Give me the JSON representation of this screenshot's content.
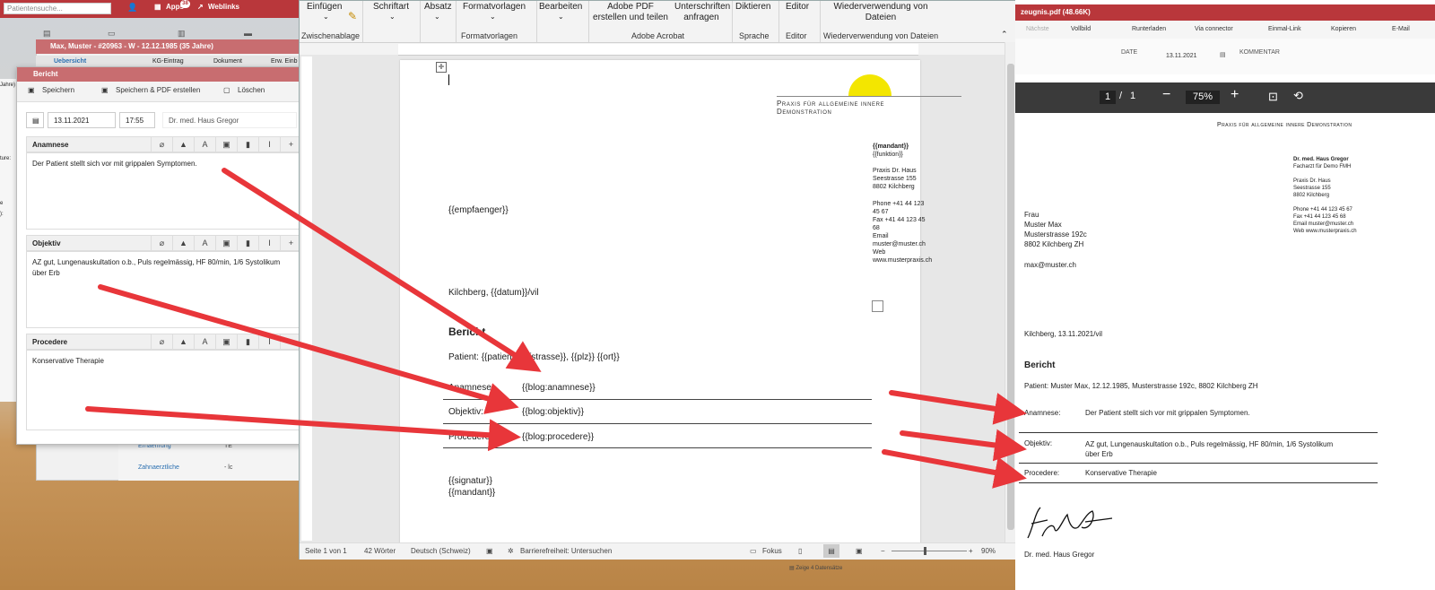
{
  "ehr": {
    "search_placeholder": "Patientensuche...",
    "top_apps": "Apps",
    "top_apps_badge": "38",
    "top_weblinks": "Weblinks",
    "back_window_title": "Max, Muster - #20963 - W - 12.12.1985 (35 Jahre)",
    "back_tabs": [
      "Uebersicht",
      "KG-Eintrag",
      "Dokument",
      "Erw. Einb"
    ],
    "list_items": [
      "Ernaehrung",
      "Zahnaerztliche"
    ],
    "list_values": [
      "TE",
      "- lc"
    ],
    "sidebar_fragments": [
      "Jahre)",
      "ture:",
      "e",
      "):"
    ]
  },
  "modal": {
    "title": "Bericht",
    "btn_save": "Speichern",
    "btn_save_pdf": "Speichern & PDF erstellen",
    "btn_delete": "Löschen",
    "date": "13.11.2021",
    "time": "17:55",
    "doctor": "Dr. med. Haus Gregor",
    "sections": [
      {
        "label": "Anamnese",
        "text": "Der Patient stellt sich vor mit grippalen Symptomen."
      },
      {
        "label": "Objektiv",
        "text": "AZ gut, Lungenauskultation o.b., Puls regelmässig, HF 80/min, 1/6 Systolikum über Erb"
      },
      {
        "label": "Procedere",
        "text": "Konservative Therapie"
      }
    ]
  },
  "word": {
    "ribbon": {
      "einfuegen": "Einfügen",
      "zwischenablage": "Zwischenablage",
      "schriftart": "Schriftart",
      "absatz": "Absatz",
      "formatvorlagen": "Formatvorlagen",
      "formatvorlagen_group": "Formatvorlagen",
      "bearbeiten": "Bearbeiten",
      "adobe_pdf": "Adobe PDF erstellen und teilen",
      "unterschriften": "Unterschriften anfragen",
      "adobe_group": "Adobe Acrobat",
      "diktieren": "Diktieren",
      "sprache": "Sprache",
      "editor": "Editor",
      "editor_group": "Editor",
      "wiederverwendung": "Wiederverwendung von Dateien",
      "wiederverwendung_group": "Wiederverwendung von Dateien"
    },
    "doc": {
      "praxis_title": "Praxis für allgemeine innere Demonstration",
      "mandant": "{{mandant}}",
      "funktion": "{{funktion}}",
      "address": [
        "Praxis Dr. Haus",
        "Seestrasse 155",
        "8802 Kilchberg"
      ],
      "contact": [
        "Phone +41 44 123 45 67",
        "Fax +41 44 123 45 68",
        "Email muster@muster.ch",
        "Web www.musterpraxis.ch"
      ],
      "empfaenger": "{{empfaenger}}",
      "datum_line": "Kilchberg, {{datum}}/vil",
      "heading": "Bericht",
      "patient_line": "Patient: {{patient}}, {{strasse}}, {{plz}} {{ort}}",
      "rows": [
        {
          "label": "Anamnese:",
          "value": "{{blog:anamnese}}"
        },
        {
          "label": "Objektiv:",
          "value": "{{blog:objektiv}}"
        },
        {
          "label": "Procedere:",
          "value": "{{blog:procedere}}"
        }
      ],
      "signatur": "{{signatur}}",
      "mandant_end": "{{mandant}}"
    },
    "status": {
      "page": "Seite 1 von 1",
      "words": "42 Wörter",
      "language": "Deutsch (Schweiz)",
      "accessibility": "Barrierefreiheit: Untersuchen",
      "focus": "Fokus",
      "zoom": "90%"
    }
  },
  "pdf": {
    "tab_title": "zeugnis.pdf (48.66K)",
    "tools": [
      "Nächste",
      "Vollbild",
      "Runterladen",
      "Via connector",
      "Einmal-Link",
      "Kopieren",
      "E-Mail"
    ],
    "meta_date_label": "DATE",
    "meta_date": "13.11.2021",
    "meta_comment_label": "KOMMENTAR",
    "page_current": "1",
    "page_sep": "/",
    "page_total": "1",
    "zoom": "75%",
    "doc": {
      "praxis_title": "Praxis für allgemeine innere Demonstration",
      "doctor": "Dr. med. Haus Gregor",
      "doctor_title": "Facharzt für Demo FMH",
      "address": [
        "Praxis Dr. Haus",
        "Seestrasse 155",
        "8802 Kilchberg"
      ],
      "contact": [
        "Phone +41 44 123 45 67",
        "Fax +41 44 123 45 68",
        "Email muster@muster.ch",
        "Web www.musterpraxis.ch"
      ],
      "recipient": [
        "Frau",
        "Muster Max",
        "Musterstrasse 192c",
        "8802 Kilchberg ZH"
      ],
      "email": "max@muster.ch",
      "datum_line": "Kilchberg, 13.11.2021/vil",
      "heading": "Bericht",
      "patient_line": "Patient: Muster Max, 12.12.1985, Musterstrasse 192c, 8802 Kilchberg ZH",
      "rows": [
        {
          "label": "Anamnese:",
          "value": "Der Patient stellt sich vor mit grippalen Symptomen."
        },
        {
          "label": "Objektiv:",
          "value": "AZ gut, Lungenauskultation o.b., Puls regelmässig, HF 80/min, 1/6 Systolikum über Erb"
        },
        {
          "label": "Procedere:",
          "value": "Konservative Therapie"
        }
      ],
      "signer": "Dr. med. Haus Gregor"
    },
    "footer_text": "Zeige 4 Datensätze"
  },
  "colors": {
    "arrow": "#e8363a",
    "brand": "#b9373b",
    "sun": "#f3e600"
  }
}
